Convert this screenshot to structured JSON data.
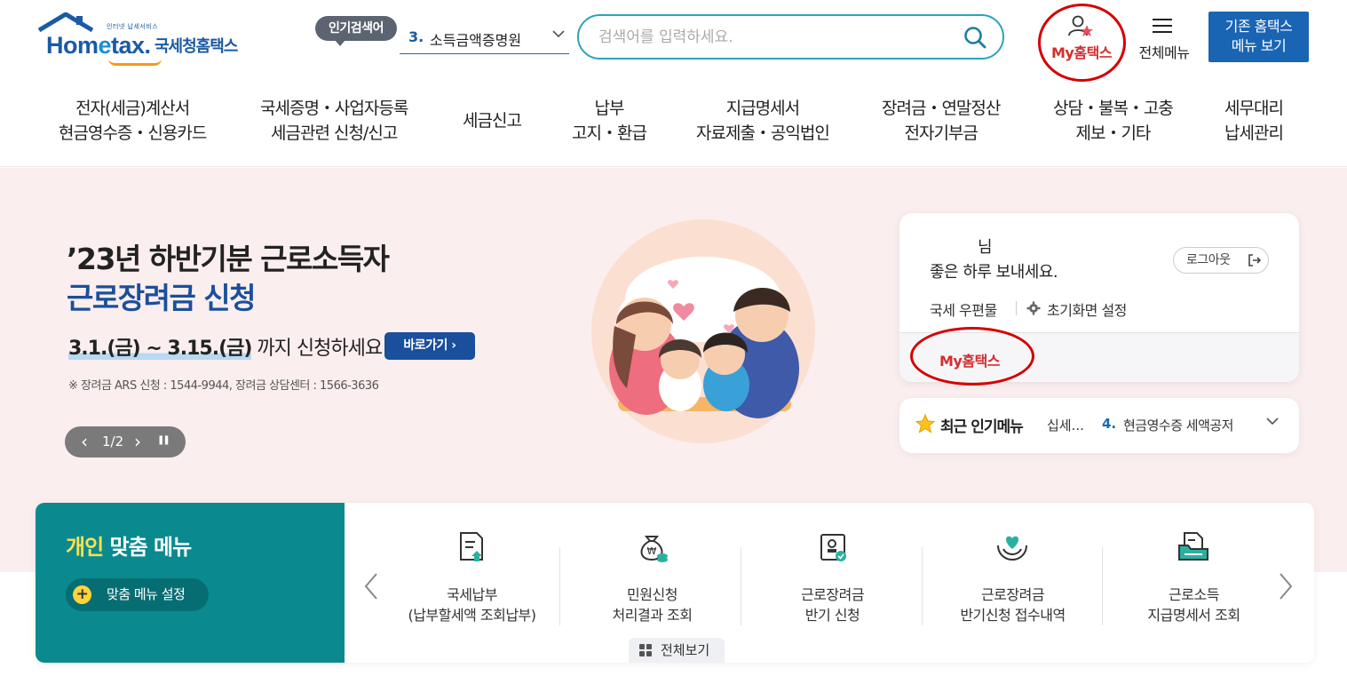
{
  "header": {
    "logo": {
      "sub": "인터넷 납세서비스",
      "main_pre": "Hom",
      "main_e": "e",
      "main_post": "tax.",
      "kr": "국세청홈택스"
    },
    "popular": {
      "badge": "인기검색어",
      "rank": "3.",
      "term": "소득금액증명원"
    },
    "search": {
      "placeholder": "검색어를 입력하세요."
    },
    "myhome_label": "My홈택스",
    "allmenu_label": "전체메뉴",
    "legacy_line1": "기존 홈택스",
    "legacy_line2": "메뉴 보기"
  },
  "gnb": [
    {
      "l1": "전자(세금)계산서",
      "l2": "현금영수증・신용카드"
    },
    {
      "l1": "국세증명・사업자등록",
      "l2": "세금관련 신청/신고"
    },
    {
      "l1": "세금신고",
      "l2": ""
    },
    {
      "l1": "납부",
      "l2": "고지・환급"
    },
    {
      "l1": "지급명세서",
      "l2": "자료제출・공익법인"
    },
    {
      "l1": "장려금・연말정산",
      "l2": "전자기부금"
    },
    {
      "l1": "상담・불복・고충",
      "l2": "제보・기타"
    },
    {
      "l1": "세무대리",
      "l2": "납세관리"
    }
  ],
  "banner": {
    "title1": "’23년 하반기분 근로소득자",
    "title2": "근로장려금 신청",
    "date_hl": "3.1.(금) ~ 3.15.(금)",
    "date_rest": " 까지 신청하세요!",
    "go_label": "바로가기 ›",
    "note": "※ 장려금 ARS 신청 : 1544-9944, 장려금 상담센터 : 1566-3636",
    "pager": {
      "prev": "‹",
      "page": "1/2",
      "next": "›",
      "pause": "❚❚"
    }
  },
  "login_card": {
    "nim": "님",
    "greeting": "좋은 하루 보내세요.",
    "logout": "로그아웃",
    "post": "국세 우편물",
    "init_setting": "초기화면 설정",
    "myhome": "My홈택스"
  },
  "recent": {
    "title": "최근 인기메뉴",
    "clipped": "십세...",
    "rank": "4.",
    "item": "현금영수증 세액공저"
  },
  "custom_menu": {
    "title_hl": "개인",
    "title_rest": " 맞춤 메뉴",
    "setting": "맞춤 메뉴 설정",
    "items": [
      {
        "icon": "tax-payment-icon",
        "l1": "국세납부",
        "l2": "(납부할세액 조회납부)"
      },
      {
        "icon": "money-bag-icon",
        "l1": "민원신청",
        "l2": "처리결과 조회"
      },
      {
        "icon": "document-stamp-icon",
        "l1": "근로장려금",
        "l2": "반기 신청"
      },
      {
        "icon": "heart-hands-icon",
        "l1": "근로장려금",
        "l2": "반기신청 접수내역"
      },
      {
        "icon": "folder-document-icon",
        "l1": "근로소득",
        "l2": "지급명세서 조회"
      }
    ],
    "view_all": "전체보기"
  },
  "colors": {
    "brand_blue": "#1a5aa6",
    "teal": "#0a8a8f",
    "highlight_red": "#d40000",
    "banner_bg": "#fbeeef"
  }
}
